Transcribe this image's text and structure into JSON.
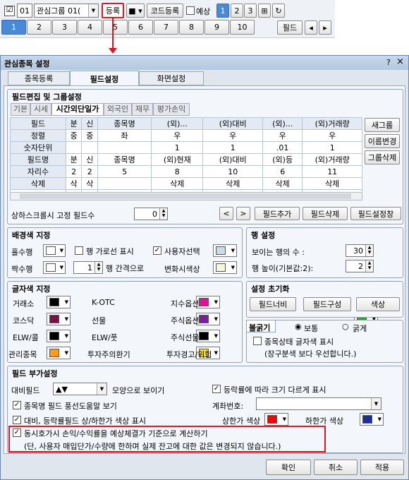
{
  "toolbar": {
    "num": "01",
    "group_select": "관심그룹 01(",
    "register": "등록",
    "code_register": "코드등록",
    "forecast": "예상",
    "pages": [
      "1",
      "2",
      "3"
    ],
    "field_btn": "필드"
  },
  "tabs_row": [
    "1",
    "2",
    "3",
    "4",
    "5",
    "6",
    "7",
    "8",
    "9",
    "10"
  ],
  "dialog": {
    "title": "관심종목 설정",
    "help": "?",
    "close": "×",
    "tabs": [
      "종목등록",
      "필드설정",
      "화면설정"
    ],
    "field_edit": {
      "title": "필드편집 및 그룹설정",
      "subtabs": [
        "기본",
        "시세",
        "시간외단일가",
        "외국인",
        "재무",
        "평가손익"
      ],
      "rows": [
        [
          "필드",
          "분",
          "신",
          "종목명",
          "(외)...",
          "(외)대비",
          "(외)...",
          "(외)거래량"
        ],
        [
          "정렬",
          "중",
          "중",
          "좌",
          "우",
          "우",
          "우",
          "우"
        ],
        [
          "숫자단위",
          "",
          "",
          "",
          "1",
          "1",
          ".01",
          "1"
        ],
        [
          "필드명",
          "분",
          "신",
          "종목명",
          "(외)현재",
          "(외)대비",
          "(외)등",
          "(외)거래량"
        ],
        [
          "자리수",
          "2",
          "2",
          "5",
          "8",
          "10",
          "6",
          "11"
        ],
        [
          "삭제",
          "삭",
          "삭",
          "",
          "삭제",
          "삭제",
          "삭제",
          "삭제"
        ]
      ],
      "side_buttons": [
        "새그룹",
        "이름변경",
        "그룹삭제"
      ],
      "fixed_label": "상하스크롤시 고정 필드수",
      "fixed_value": "0",
      "buttons": [
        "필드추가",
        "필드삭제",
        "필드설정창"
      ]
    },
    "bg": {
      "title": "배경색 지정",
      "odd": "홀수행",
      "even": "짝수행",
      "hline": "행 가로선 표시",
      "user_sel": "사용자선택",
      "gap_value": "1",
      "gap": "행 간격으로",
      "change": "변화시색상"
    },
    "row": {
      "title": "행 설정",
      "visible": "보이는 행의 수 :",
      "visible_value": "30",
      "height": "행 높이(기본값:2):",
      "height_value": "2"
    },
    "font": {
      "title": "글자색 지정",
      "items": [
        {
          "label": "거래소",
          "color": "#000000"
        },
        {
          "label": "K-OTC",
          "color": "#e0119b"
        },
        {
          "label": "지수옵션",
          "color": "#2f9e3a"
        },
        {
          "label": "코스닥",
          "color": "#7a1248"
        },
        {
          "label": "선물",
          "color": "#7b1fa2"
        },
        {
          "label": "주식옵션",
          "color": "#2f9e3a"
        },
        {
          "label": "ELW/콜",
          "color": "#000000"
        },
        {
          "label": "ELW/풋",
          "color": "#000000"
        },
        {
          "label": "주식선물",
          "color": "#1b3aa8"
        },
        {
          "label": "관리종목",
          "color": "#ff9a1a"
        },
        {
          "label": "투자주의환기",
          "color": "#ffe600"
        },
        {
          "label": "투자경고/위험",
          "color": "#b5706b"
        }
      ]
    },
    "init": {
      "title": "설정 초기화",
      "buttons": [
        "필드너비",
        "필드구성",
        "색상"
      ]
    },
    "bold": {
      "title": "볼굵기",
      "normal": "보통",
      "bold": "굵게",
      "status": "종목상태 글자색 표시",
      "note": "(장구분색 보다 우선합니다.)"
    },
    "extra": {
      "title": "필드 부가설정",
      "compare": "대비필드",
      "compare_value": "▲▼",
      "compare_suffix": "모양으로 보이기",
      "rate": "등락률에 따라 크기 다르게 표시",
      "name_scroll": "종목명 필드 풍선도움말 보기",
      "account": "계좌번호:",
      "colors": "대비, 등락률필드 상/하한가 색상 표시",
      "upper": "상한가 색상",
      "lower": "하한가 색상",
      "upper_color": "#ff0000",
      "lower_color": "#1b2ea0",
      "forecast_line1": "동시호가시 손익/수익률을 예상체결가 기준으로 계산하기",
      "forecast_line2": "(단, 사용자 매입단가/수량에 한하며 실제 잔고에 대한 값은 변경되지 않습니다.)"
    },
    "footer": [
      "확인",
      "취소",
      "적용"
    ]
  }
}
